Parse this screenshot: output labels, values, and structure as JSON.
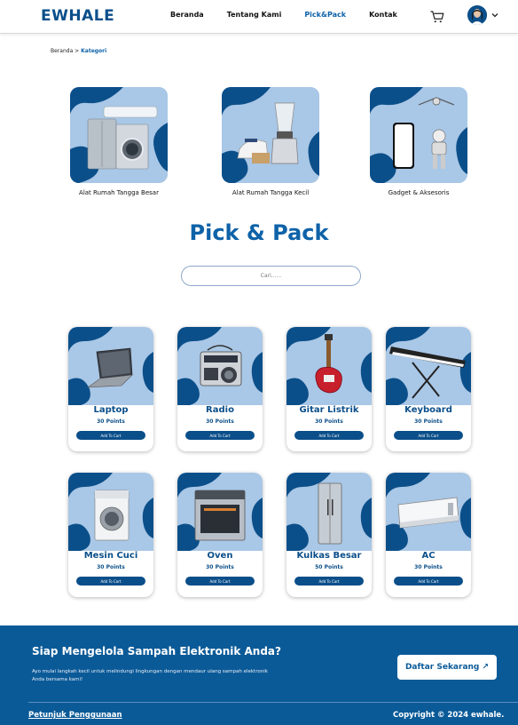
{
  "brand": {
    "logo": "EWHALE",
    "primary": "#0e62a8",
    "dark": "#0b4f8a",
    "tile_bg": "#a9c7e6"
  },
  "nav": {
    "links": [
      "Beranda",
      "Tentang Kami",
      "Pick&Pack",
      "Kontak"
    ],
    "active": "Pick&Pack",
    "icons": [
      "cart-icon",
      "avatar",
      "chevron-down-icon"
    ]
  },
  "breadcrumb": {
    "home": "Beranda",
    "separator": ">",
    "current": "Kategori"
  },
  "categories": [
    {
      "label": "Alat Rumah Tangga Besar",
      "icon": "washing-machine-icon"
    },
    {
      "label": "Alat Rumah Tangga Kecil",
      "icon": "blender-icon"
    },
    {
      "label": "Gadget & Aksesoris",
      "icon": "smartphone-icon"
    }
  ],
  "page_title": "Pick & Pack",
  "search": {
    "placeholder": "Cari......",
    "value": ""
  },
  "products": [
    {
      "name": "Laptop",
      "points": "30 Points",
      "button": "Add To Cart",
      "icon": "laptop-icon"
    },
    {
      "name": "Radio",
      "points": "30 Points",
      "button": "Add To Cart",
      "icon": "radio-icon"
    },
    {
      "name": "Gitar Listrik",
      "points": "30 Points",
      "button": "Add To Cart",
      "icon": "guitar-icon"
    },
    {
      "name": "Keyboard",
      "points": "30 Points",
      "button": "Add To Cart",
      "icon": "keyboard-icon"
    },
    {
      "name": "Mesin Cuci",
      "points": "30 Points",
      "button": "Add To Cart",
      "icon": "washing-machine-icon"
    },
    {
      "name": "Oven",
      "points": "30 Points",
      "button": "Add To Cart",
      "icon": "oven-icon"
    },
    {
      "name": "Kulkas Besar",
      "points": "50 Points",
      "button": "Add To Cart",
      "icon": "fridge-icon"
    },
    {
      "name": "AC",
      "points": "30 Points",
      "button": "Add To Cart",
      "icon": "air-conditioner-icon"
    }
  ],
  "footer": {
    "title": "Siap Mengelola Sampah Elektronik Anda?",
    "description": "Ayo mulai langkah kecil untuk melindungi lingkungan dengan mendaur ulang sampah elektronik Anda bersama kami!",
    "cta": "Daftar Sekarang ↗",
    "guide": "Petunjuk Penggunaan",
    "copyright": "Copyright © 2024 ewhale."
  }
}
